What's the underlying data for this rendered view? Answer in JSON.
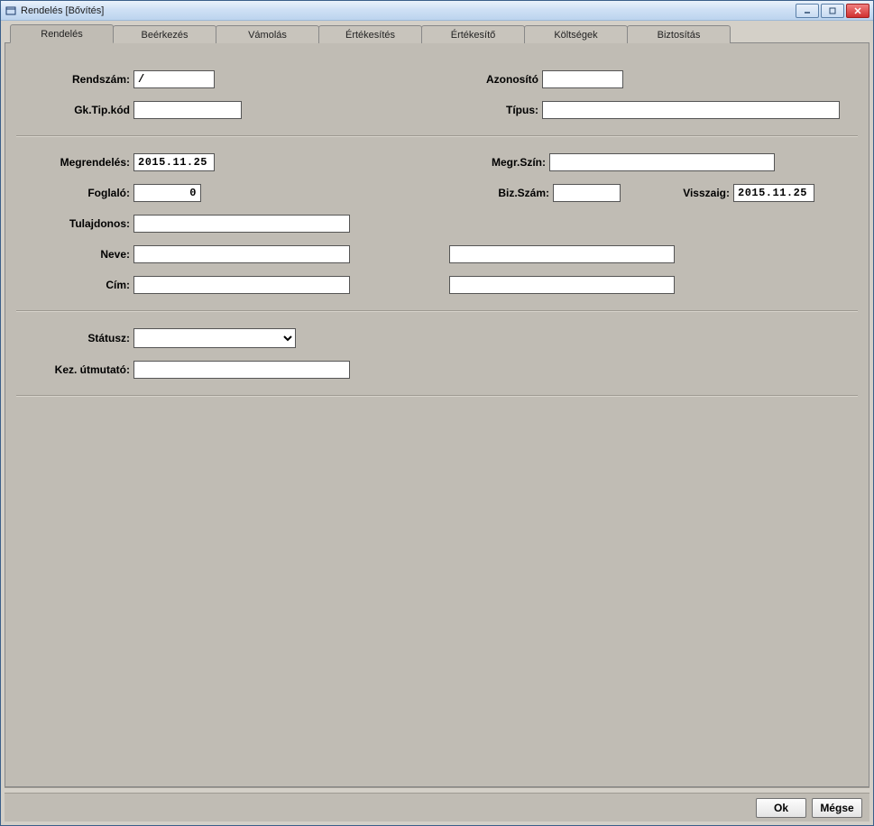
{
  "window": {
    "title": "Rendelés [Bővítés]"
  },
  "tabs": [
    {
      "label": "Rendelés",
      "active": true
    },
    {
      "label": "Beérkezés",
      "active": false
    },
    {
      "label": "Vámolás",
      "active": false
    },
    {
      "label": "Értékesítés",
      "active": false
    },
    {
      "label": "Értékesítő",
      "active": false
    },
    {
      "label": "Költségek",
      "active": false
    },
    {
      "label": "Biztosítás",
      "active": false
    }
  ],
  "form": {
    "rendszam_label": "Rendszám:",
    "rendszam_value": "/",
    "azonosito_label": "Azonosító",
    "azonosito_value": "",
    "gktipkod_label": "Gk.Tip.kód",
    "gktipkod_value": "",
    "tipus_label": "Típus:",
    "tipus_value": "",
    "megrendeles_label": "Megrendelés:",
    "megrendeles_value": "2015.11.25",
    "megrszin_label": "Megr.Szín:",
    "megrszin_value": "",
    "foglalo_label": "Foglaló:",
    "foglalo_value": "0",
    "bizszam_label": "Biz.Szám:",
    "bizszam_value": "",
    "visszaig_label": "Visszaig:",
    "visszaig_value": "2015.11.25",
    "tulajdonos_label": "Tulajdonos:",
    "tulajdonos_value": "",
    "neve_label": "Neve:",
    "neve_value1": "",
    "neve_value2": "",
    "cim_label": "Cím:",
    "cim_value1": "",
    "cim_value2": "",
    "statusz_label": "Státusz:",
    "statusz_value": "",
    "kezutmutato_label": "Kez. útmutató:",
    "kezutmutato_value": ""
  },
  "footer": {
    "ok": "Ok",
    "cancel": "Mégse"
  }
}
